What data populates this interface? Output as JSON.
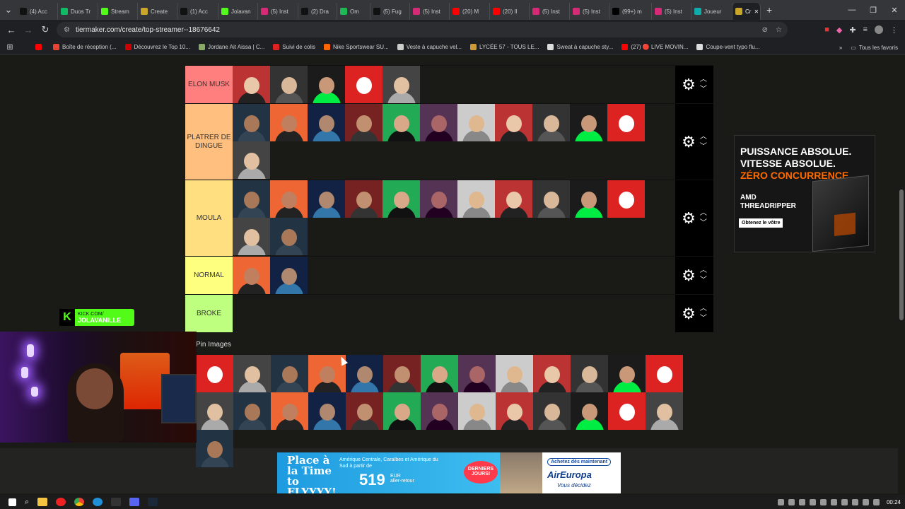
{
  "browser": {
    "tabs": [
      {
        "label": "(4) Acc",
        "fav": "#111"
      },
      {
        "label": "Duos Tr",
        "fav": "#1b6"
      },
      {
        "label": "Stream",
        "fav": "#53fc18"
      },
      {
        "label": "Create",
        "fav": "#c9a62a"
      },
      {
        "label": "(1) Acc",
        "fav": "#111"
      },
      {
        "label": "Jolavan",
        "fav": "#53fc18"
      },
      {
        "label": "(5) Inst",
        "fav": "#d62976"
      },
      {
        "label": "(2) Dra",
        "fav": "#111"
      },
      {
        "label": "Om",
        "fav": "#1db954"
      },
      {
        "label": "(5) Fug",
        "fav": "#111"
      },
      {
        "label": "(5) Inst",
        "fav": "#d62976"
      },
      {
        "label": "(20) M",
        "fav": "#f00"
      },
      {
        "label": "(20) Il",
        "fav": "#f00"
      },
      {
        "label": "(5) Inst",
        "fav": "#d62976"
      },
      {
        "label": "(5) Inst",
        "fav": "#d62976"
      },
      {
        "label": "(99+) m",
        "fav": "#000"
      },
      {
        "label": "(5) Inst",
        "fav": "#d62976"
      },
      {
        "label": "Joueur",
        "fav": "#1aa"
      },
      {
        "label": "Cr",
        "fav": "#c9a62a",
        "active": true
      }
    ],
    "new_tab": "+",
    "url": "tiermaker.com/create/top-streamer--18676642",
    "bookmarks": [
      {
        "label": "",
        "color": "#f00"
      },
      {
        "label": "Boîte de réception (...",
        "color": "#ea4335"
      },
      {
        "label": "Découvrez le Top 10...",
        "color": "#c00"
      },
      {
        "label": "Jordane Ait Aissa | C...",
        "color": "#8a6"
      },
      {
        "label": "Suivi de colis",
        "color": "#d22"
      },
      {
        "label": "Nike Sportswear SU...",
        "color": "#f60"
      },
      {
        "label": "Veste à capuche vel...",
        "color": "#ccc"
      },
      {
        "label": "LYCÉE 57 - TOUS LE...",
        "color": "#c93"
      },
      {
        "label": "Sweat à capuche sty...",
        "color": "#ddd"
      },
      {
        "label": "(27) 🔴 LIVE MOVIN...",
        "color": "#f00"
      },
      {
        "label": "Coupe-vent typo flu...",
        "color": "#ddd"
      }
    ],
    "bookmarks_more": "»",
    "all_bookmarks": "Tous les favoris"
  },
  "tiers": [
    {
      "label": "ELON MUSK",
      "color": "#ff7f7f",
      "count": 5
    },
    {
      "label": "PLATRER DE DINGUE",
      "color": "#ffbf7f",
      "count": 12
    },
    {
      "label": "MOULA",
      "color": "#ffdf7f",
      "count": 13
    },
    {
      "label": "NORMAL",
      "color": "#ffff7f",
      "count": 2
    },
    {
      "label": "BROKE",
      "color": "#bfff7f",
      "count": 0
    }
  ],
  "pin_images_title": "Pin Images",
  "pool_count": 27,
  "kick": {
    "url": "KICK.COM/",
    "name": "JOLAVANILLE"
  },
  "ad_right": {
    "line1": "PUISSANCE ABSOLUE.",
    "line2": "VITESSE ABSOLUE.",
    "line3": "ZÉRO CONCURRENCE.",
    "brand": "AMD",
    "product": "THREADRIPPER",
    "cta": "Obtenez le vôtre"
  },
  "ad_bottom": {
    "headline": "Place à la Time to FLYYYY!",
    "sub": "Amérique Centrale, Caraïbes et Amérique du Sud à partir de",
    "price": "519",
    "currency": "EUR",
    "trip": "aller-retour",
    "badge": "DERNIERS JOURS!",
    "button": "Achetez dès maintenant",
    "brand": "AirEuropa",
    "slogan": "Vous décidez"
  },
  "taskbar": {
    "time": "00:24"
  }
}
